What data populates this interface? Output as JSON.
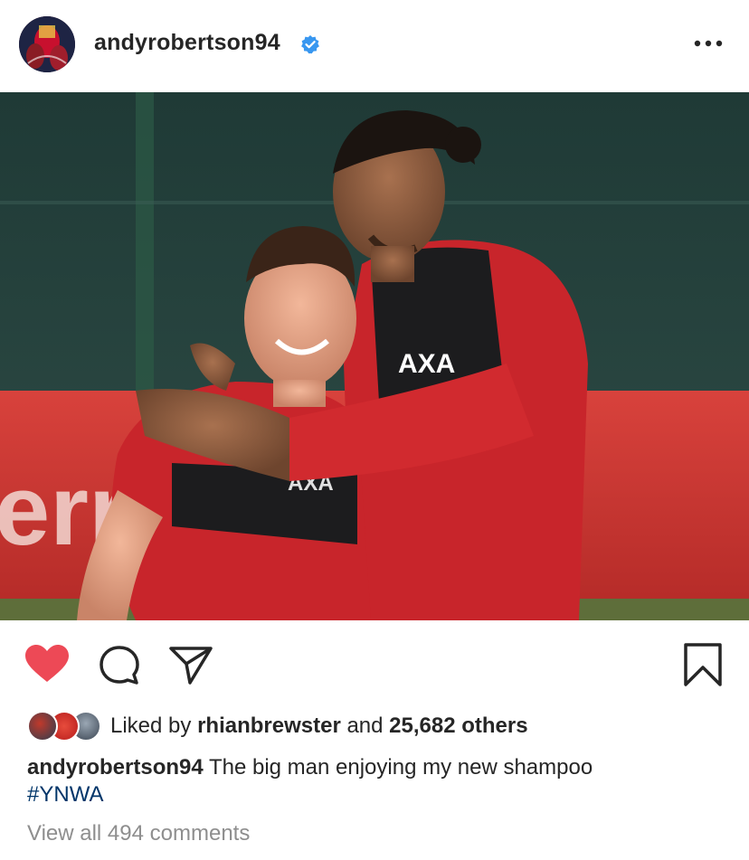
{
  "post": {
    "username": "andyrobertson94",
    "verified": true,
    "verified_color": "#3897f0",
    "photo_watermark_text": "err",
    "jersey_sponsor": "AXA"
  },
  "actions": {
    "like_icon": "heart-filled-icon",
    "like_color": "#ed4956",
    "comment_icon": "comment-icon",
    "share_icon": "paper-plane-icon",
    "save_icon": "bookmark-icon"
  },
  "likes": {
    "prefix": "Liked by",
    "liker": "rhianbrewster",
    "joiner": "and",
    "others": "25,682 others"
  },
  "caption": {
    "username": "andyrobertson94",
    "text": "The big man enjoying my new shampoo",
    "hashtag": "#YNWA",
    "hashtag_color": "#003569"
  },
  "comments": {
    "view_all": "View all 494 comments"
  }
}
